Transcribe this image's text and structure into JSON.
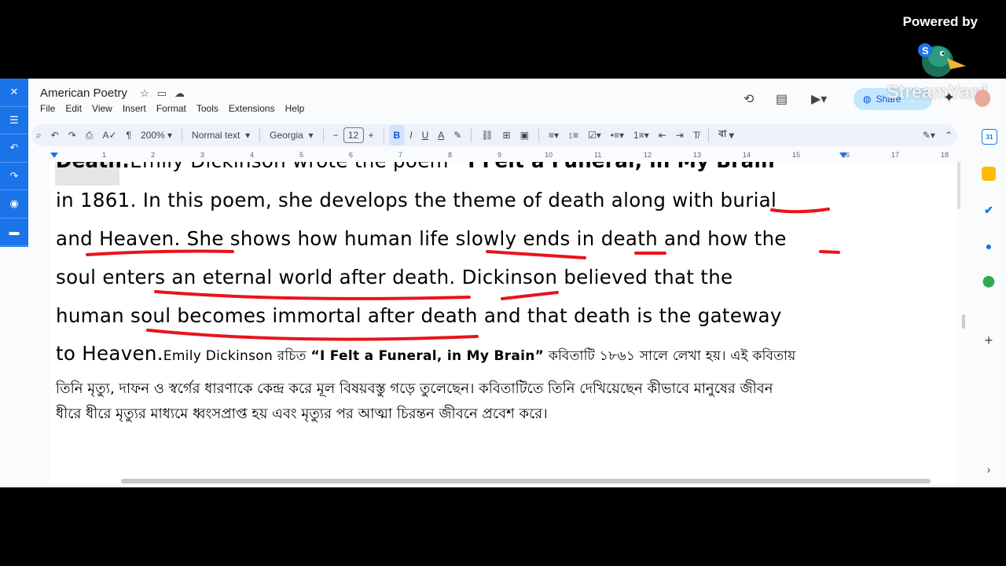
{
  "overlay": {
    "powered_by": "Powered by",
    "streamyard": "StreamYard"
  },
  "doc": {
    "title": "American Poetry",
    "menus": [
      "File",
      "Edit",
      "View",
      "Insert",
      "Format",
      "Tools",
      "Extensions",
      "Help"
    ],
    "share_label": "Share"
  },
  "toolbar": {
    "zoom": "200%",
    "style": "Normal text",
    "font": "Georgia",
    "font_size": "12",
    "bold": "B",
    "italic": "I",
    "underline": "U",
    "text_color": "A",
    "lang": "বা"
  },
  "ruler": [
    "1",
    "2",
    "3",
    "4",
    "5",
    "6",
    "7",
    "8",
    "9",
    "10",
    "11",
    "12",
    "13",
    "14",
    "15",
    "16",
    "17",
    "18"
  ],
  "content": {
    "line0_bold": "Death:",
    "line0_text": "Emily Dickinson wrote the poem ",
    "line0_poem": "“I Felt a Funeral, in My Brain”",
    "line1": "in 1861. In this poem, she develops the theme of death along with burial",
    "line2": "and Heaven. She shows how human life slowly ends in death and how the",
    "line3": "soul enters an eternal world after death. Dickinson believed that the",
    "line4": "human soul becomes immortal after death and that death is the gateway",
    "line5_big": "to Heaven.",
    "line5_small": "Emily Dickinson রচিত ",
    "line5_poem": "“I Felt a Funeral, in My Brain”",
    "line5_rest": " কবিতাটি ১৮৬১ সালে লেখা হয়। এই কবিতায়",
    "line6": "তিনি মৃত্যু, দাফন ও স্বর্গের ধারণাকে কেন্দ্র করে মূল বিষয়বস্তু গড়ে তুলেছেন। কবিতাটিতে তিনি দেখিয়েছেন কীভাবে মানুষের জীবন",
    "line7": "ধীরে ধীরে মৃত্যুর মাধ্যমে ধ্বংসপ্রাপ্ত হয় এবং মৃত্যুর পর আত্মা চিরন্তন জীবনে প্রবেশ করে।"
  },
  "colors": {
    "annotation": "#e8141c",
    "accent": "#1a73e8"
  }
}
